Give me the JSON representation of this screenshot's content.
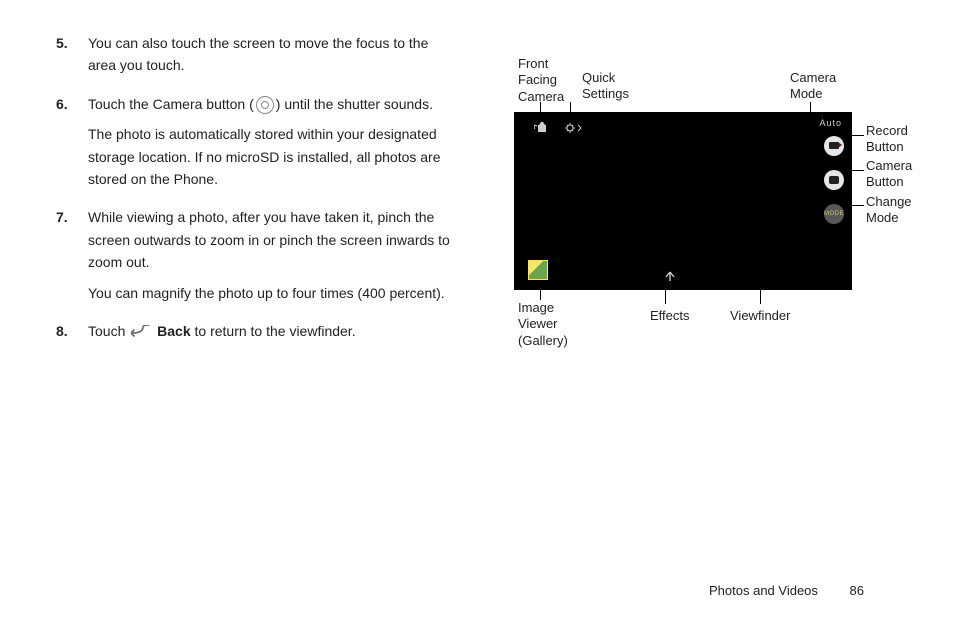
{
  "steps": {
    "s5": {
      "num": "5.",
      "p1": "You can also touch the screen to move the focus to the area you touch."
    },
    "s6": {
      "num": "6.",
      "p1a": "Touch the Camera button (",
      "p1b": ") until the shutter sounds.",
      "p2": "The photo is automatically stored within your designated storage location. If no microSD is installed, all photos are stored on the Phone."
    },
    "s7": {
      "num": "7.",
      "p1": "While viewing a photo, after you have taken it, pinch the screen outwards to zoom in or pinch the screen inwards to zoom out.",
      "p2": "You can magnify the photo up to four times (400 percent)."
    },
    "s8": {
      "num": "8.",
      "p1a": "Touch ",
      "boldword": "Back",
      "p1b": " to return to the viewfinder."
    }
  },
  "callouts": {
    "front": "Front\nFacing\nCamera",
    "quick": "Quick\nSettings",
    "mode": "Camera\nMode",
    "record": "Record\nButton",
    "camera": "Camera\nButton",
    "change": "Change\nMode",
    "image": "Image\nViewer\n(Gallery)",
    "effects": "Effects",
    "viewfinder": "Viewfinder"
  },
  "camera": {
    "auto": "Auto",
    "modebtn": "MODE"
  },
  "footer": {
    "section": "Photos and Videos",
    "page": "86"
  }
}
